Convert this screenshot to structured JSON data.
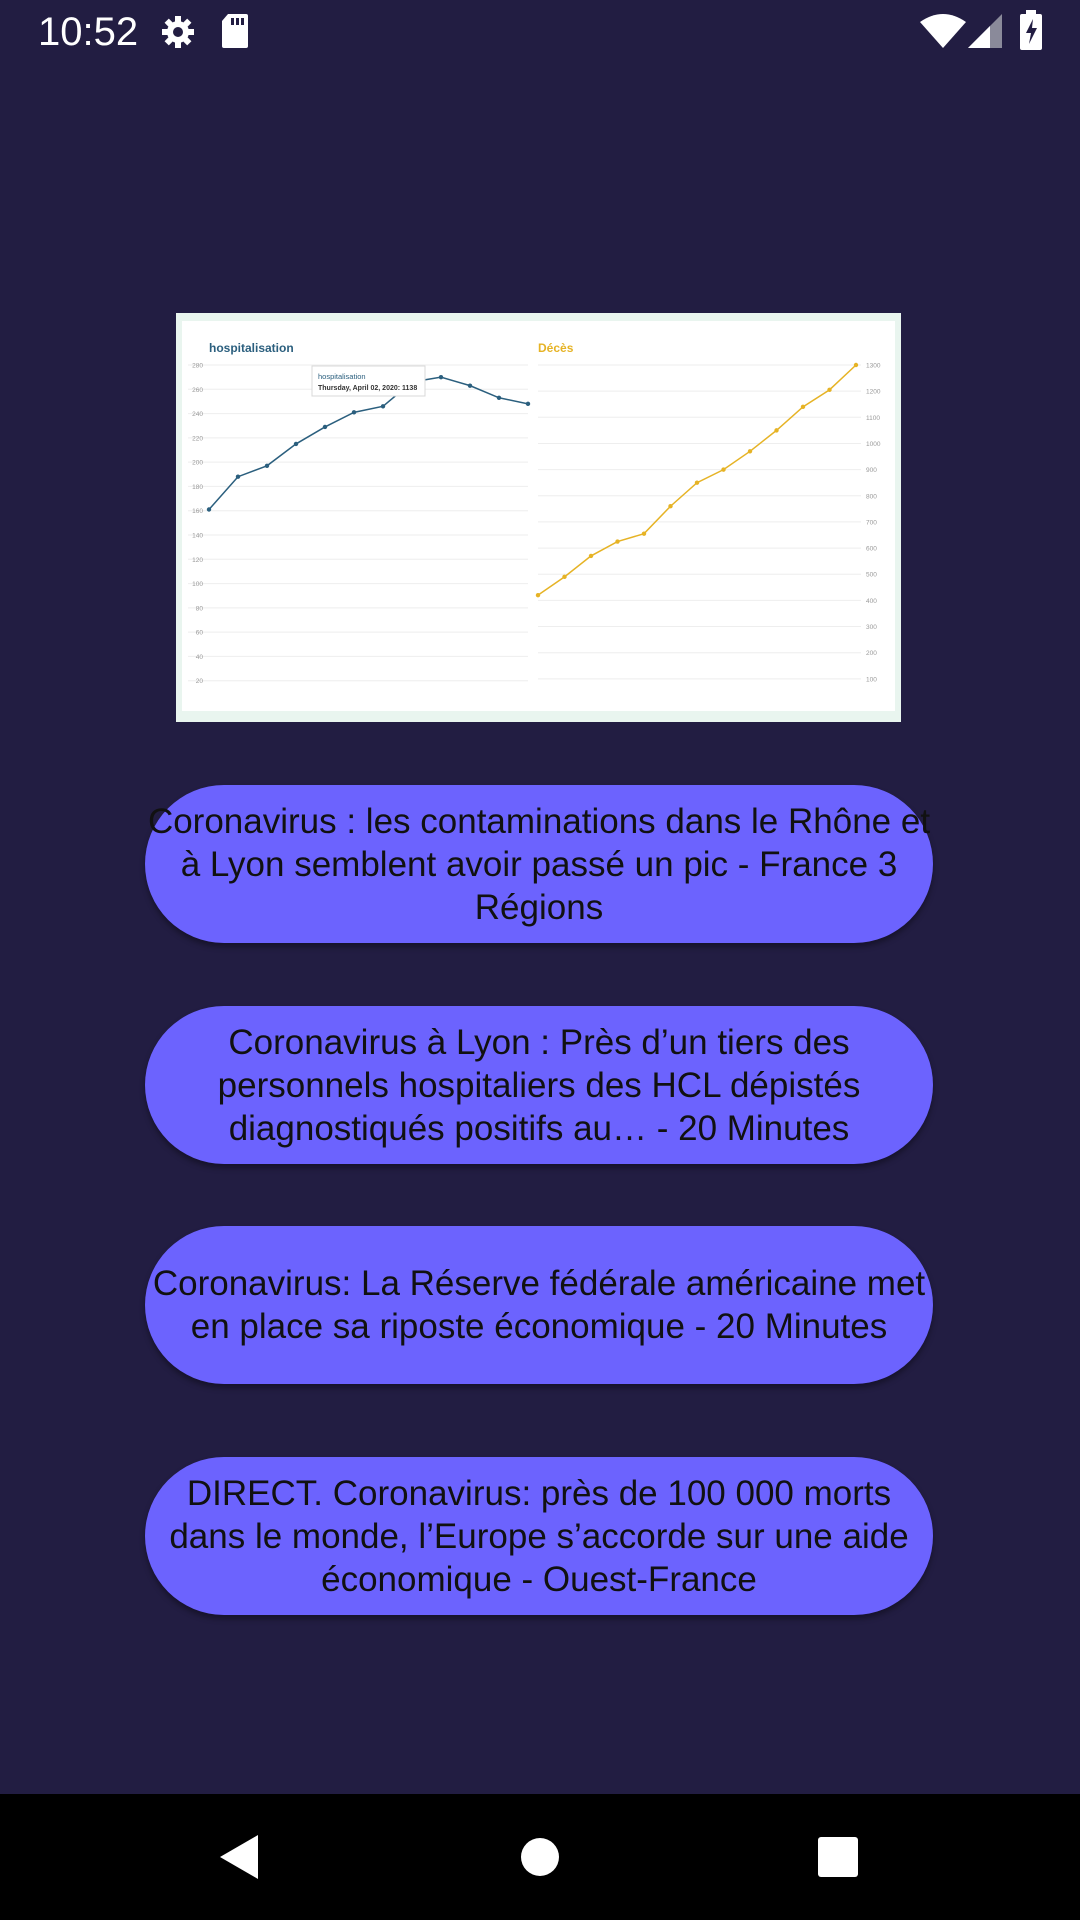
{
  "status_bar": {
    "time": "10:52",
    "icons": [
      "gear-icon",
      "sd-card-icon",
      "wifi-icon",
      "signal-icon",
      "battery-charging-icon"
    ]
  },
  "chart_image": {
    "tooltip_title": "hospitalisation",
    "tooltip_text": "Thursday, April 02, 2020: 1138",
    "chart_data": [
      {
        "type": "line",
        "title": "hospitalisation",
        "color": "#2b5f7e",
        "yticks": [
          20,
          40,
          60,
          80,
          100,
          120,
          140,
          160,
          180,
          200,
          220,
          240,
          260,
          280
        ],
        "ylim": [
          0,
          280
        ],
        "values": [
          161,
          188,
          197,
          215,
          229,
          241,
          246,
          266,
          270,
          263,
          253,
          248
        ]
      },
      {
        "type": "line",
        "title": "Décès",
        "color": "#e6b325",
        "yticks": [
          100,
          200,
          300,
          400,
          500,
          600,
          700,
          800,
          900,
          1000,
          1100,
          1200,
          1300
        ],
        "ylim": [
          0,
          1300
        ],
        "values": [
          420,
          490,
          570,
          625,
          655,
          760,
          850,
          900,
          970,
          1050,
          1140,
          1205,
          1300
        ]
      }
    ]
  },
  "articles": [
    "Coronavirus : les contaminations dans le Rhône et à Lyon semblent avoir passé un pic - France 3 Régions",
    "Coronavirus à Lyon : Près d’un tiers des personnels hospitaliers des HCL dépistés diagnostiqués positifs au… - 20 Minutes",
    "Coronavirus: La Réserve fédérale américaine met en place sa riposte économique - 20 Minutes",
    "DIRECT. Coronavirus: près de 100 000 morts dans le monde, l’Europe s’accorde sur une aide économique - Ouest-France"
  ],
  "nav_bar": {
    "icons": [
      "back-icon",
      "home-icon",
      "recents-icon"
    ]
  },
  "colors": {
    "background": "#221d42",
    "button": "#6c63fe",
    "nav_bar": "#000000"
  }
}
